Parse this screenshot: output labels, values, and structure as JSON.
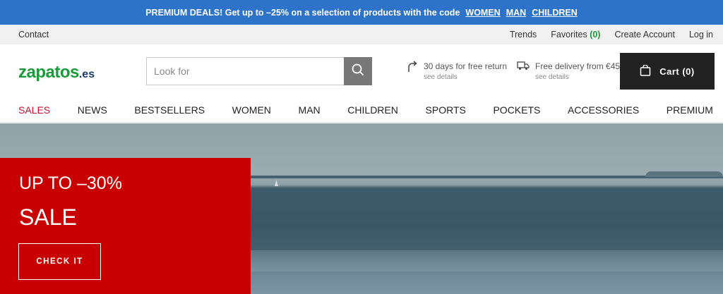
{
  "promo": {
    "text": "PREMIUM DEALS! Get up to –25% on a selection of products with the code",
    "links": [
      "WOMEN",
      "MAN",
      "CHILDREN"
    ]
  },
  "utility": {
    "contact": "Contact",
    "trends": "Trends",
    "favorites_label": "Favorites",
    "favorites_count": "(0)",
    "create_account": "Create Account",
    "login": "Log in"
  },
  "header": {
    "logo_main": "zapatos",
    "logo_tld": ".es",
    "search_placeholder": "Look for",
    "perk_return": {
      "title": "30 days for free return",
      "sub": "see details"
    },
    "perk_delivery": {
      "title": "Free delivery from €45",
      "sub": "see details"
    },
    "cart_label": "Cart (0)"
  },
  "nav": [
    "SALES",
    "NEWS",
    "BESTSELLERS",
    "WOMEN",
    "MAN",
    "CHILDREN",
    "SPORTS",
    "POCKETS",
    "ACCESSORIES",
    "PREMIUM"
  ],
  "hero": {
    "line1": "UP TO –30%",
    "line2": "SALE",
    "cta": "CHECK IT"
  },
  "colors": {
    "promo_bg": "#2d73c9",
    "brand_green": "#1a9a3a",
    "sale_red": "#c80000",
    "nav_sale": "#c8102e",
    "cart_bg": "#222222"
  }
}
